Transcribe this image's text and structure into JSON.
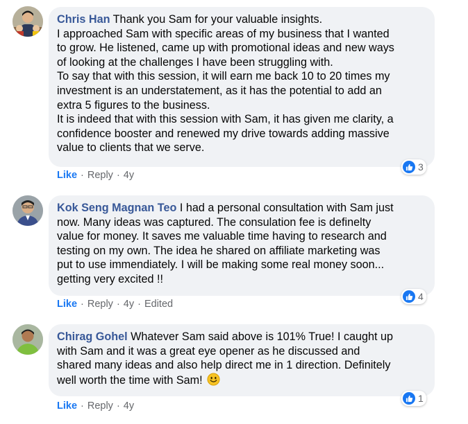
{
  "comments": [
    {
      "author": "Chris Han",
      "lines": [
        " Thank you Sam for your valuable insights.",
        "I approached Sam with specific areas of my business that I wanted",
        "to grow. He listened, came up with promotional ideas and new ways",
        "of looking at the challenges I have been struggling with.",
        "To say that with this session, it will earn me back 10 to 20 times my",
        "investment is an understatement, as it has the potential to add an",
        "extra 5 figures to the business.",
        "It is indeed that with this session with Sam, it has given me clarity, a",
        "confidence booster and renewed my drive towards adding massive",
        "value to clients that we serve."
      ],
      "reaction_count": "3",
      "like_label": "Like",
      "reply_label": "Reply",
      "time": "4y"
    },
    {
      "author": "Kok Seng Magnan Teo",
      "lines": [
        " I had a personal consultation with Sam just",
        "now. Many ideas was captured. The consulation fee is definelty",
        "value for money. It saves me valuable time having to research and",
        "testing on my own. The idea he shared on affiliate marketing was",
        "put to use immendiately. I will be making some real money soon...",
        "getting very excited !!"
      ],
      "reaction_count": "4",
      "like_label": "Like",
      "reply_label": "Reply",
      "time": "4y",
      "edited_label": "Edited"
    },
    {
      "author": "Chirag Gohel",
      "lines": [
        " Whatever Sam said above is 101% True! I caught up",
        "with Sam and it was a great eye opener as he discussed and",
        "shared many ideas and also help direct me in 1 direction. Definitely",
        "well worth the time with Sam! "
      ],
      "reaction_count": "1",
      "like_label": "Like",
      "reply_label": "Reply",
      "time": "4y"
    }
  ],
  "icons": {
    "reaction": "thumbs-up-icon",
    "emoji": "smiley-emoji-icon"
  },
  "colors": {
    "author": "#385898",
    "like_link": "#1877f2",
    "bubble": "#f0f2f5",
    "meta": "#65676b"
  }
}
